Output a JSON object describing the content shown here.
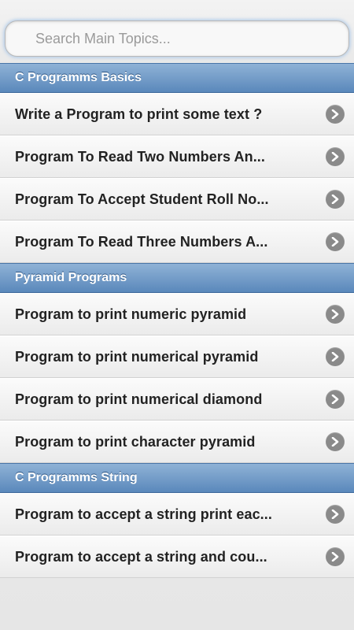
{
  "search": {
    "placeholder": "Search Main Topics..."
  },
  "sections": [
    {
      "title": "C Programms Basics",
      "items": [
        "Write a Program to print some text ?",
        "Program To Read Two Numbers An...",
        "Program To Accept Student Roll No...",
        "Program To Read Three Numbers A..."
      ]
    },
    {
      "title": "Pyramid Programs",
      "items": [
        "Program to print numeric pyramid",
        "Program to print numerical pyramid",
        "Program to print numerical diamond",
        "Program to print character pyramid"
      ]
    },
    {
      "title": "C Programms String",
      "items": [
        "Program to accept a string print eac...",
        "Program to accept a string and cou..."
      ]
    }
  ],
  "icons": {
    "item_arrow": "chevron-right-circle-icon"
  },
  "colors": {
    "divider_top": "#8fb2d6",
    "divider_bottom": "#5a88bb",
    "arrow": "#8a8a8a"
  }
}
